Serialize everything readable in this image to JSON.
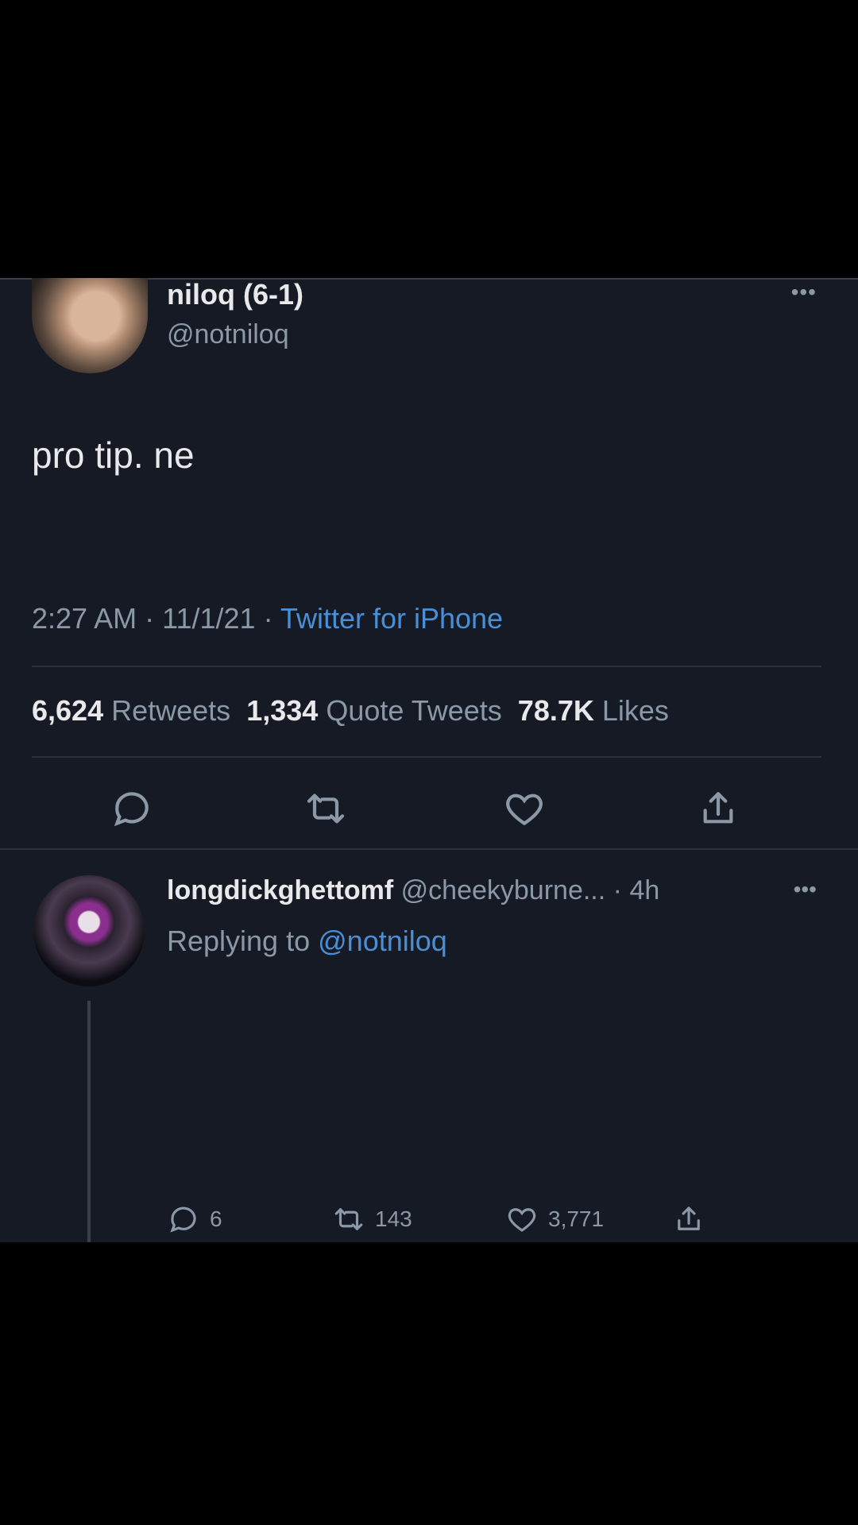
{
  "tweet": {
    "display_name": "niloq (6-1)",
    "handle": "@notniloq",
    "more_icon": "more-horizontal-icon",
    "text": "pro tip. nе",
    "time": "2:27 AM",
    "date": "11/1/21",
    "separator": "·",
    "source": "Twitter for iPhone",
    "stats": {
      "retweets_count": "6,624",
      "retweets_label": "Retweets",
      "quotes_count": "1,334",
      "quotes_label": "Quote Tweets",
      "likes_count": "78.7K",
      "likes_label": "Likes"
    },
    "actions": [
      "reply-icon",
      "retweet-icon",
      "like-icon",
      "share-icon"
    ]
  },
  "reply": {
    "display_name": "longdickghettomf",
    "handle": "@cheekyburne...",
    "time": "4h",
    "replying_prefix": "Replying to",
    "replying_to": "@notniloq",
    "counts": {
      "replies": "6",
      "retweets": "143",
      "likes": "3,771"
    }
  },
  "colors": {
    "background": "#161a24",
    "link": "#4a8fd6",
    "muted": "#8b98a5",
    "text": "#e7e9ea"
  }
}
